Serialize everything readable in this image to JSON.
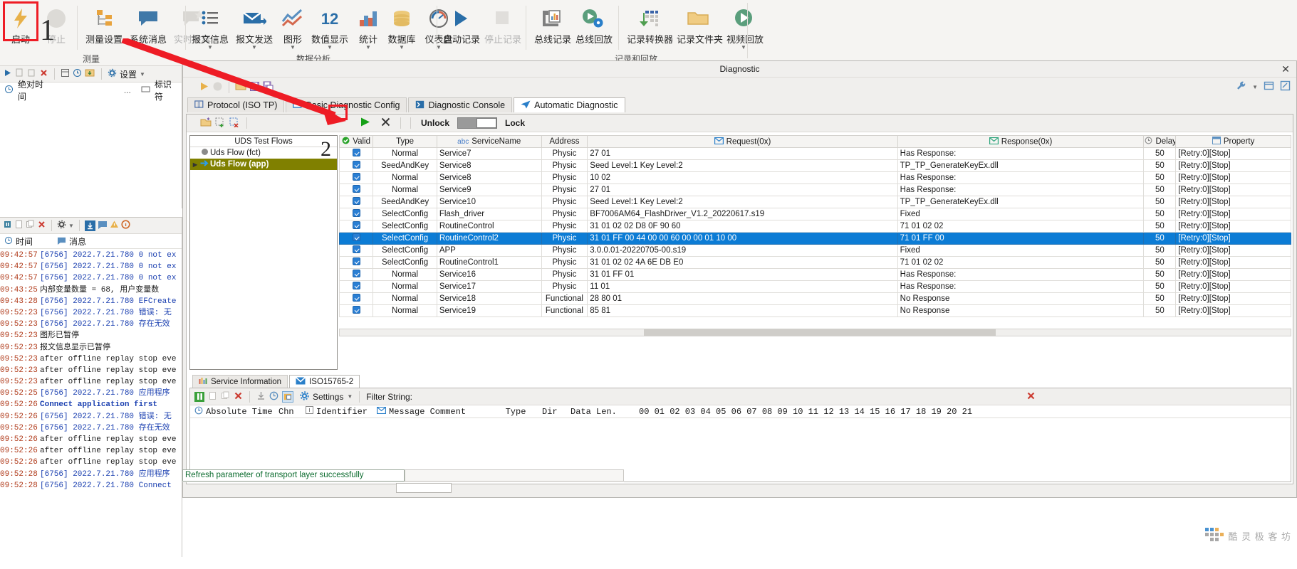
{
  "ribbon": {
    "groups": [
      {
        "name": "测量",
        "items": [
          {
            "label": "启动",
            "icon": "lightning-icon",
            "disabled": false
          },
          {
            "label": "停止",
            "icon": "stop-circle-icon",
            "disabled": true
          },
          {
            "label": "测量设置",
            "icon": "measurement-setup-icon",
            "disabled": false
          },
          {
            "label": "系统消息",
            "icon": "system-message-icon",
            "disabled": false
          },
          {
            "label": "实时注释",
            "icon": "realtime-comment-icon",
            "disabled": true
          }
        ]
      },
      {
        "name": "数据分析",
        "items": [
          {
            "label": "报文信息",
            "icon": "message-info-icon",
            "dropdown": true
          },
          {
            "label": "报文发送",
            "icon": "message-send-icon",
            "dropdown": true
          },
          {
            "label": "图形",
            "icon": "graph-icon",
            "dropdown": true
          },
          {
            "label": "数值显示",
            "icon": "numeric-display-icon",
            "dropdown": true
          },
          {
            "label": "统计",
            "icon": "statistics-icon",
            "dropdown": true
          },
          {
            "label": "数据库",
            "icon": "database-icon",
            "dropdown": true
          },
          {
            "label": "仪表盘",
            "icon": "dashboard-icon",
            "dropdown": true
          }
        ]
      },
      {
        "name": "记录和回放",
        "items": [
          {
            "label": "启动记录",
            "icon": "play-icon",
            "disabled": false
          },
          {
            "label": "停止记录",
            "icon": "stop-square-icon",
            "disabled": true
          },
          {
            "label": "总线记录",
            "icon": "bus-logging-icon",
            "disabled": false
          },
          {
            "label": "总线回放",
            "icon": "bus-replay-icon",
            "disabled": false
          },
          {
            "label": "记录转换器",
            "icon": "log-converter-icon",
            "disabled": false
          },
          {
            "label": "记录文件夹",
            "icon": "folder-icon",
            "disabled": false
          },
          {
            "label": "视频回放",
            "icon": "video-replay-icon",
            "dropdown": true
          }
        ]
      }
    ]
  },
  "left_top": {
    "toolbar_icons": [
      "play-icon",
      "copy-icon",
      "paste-icon",
      "delete-icon",
      "grid-icon",
      "clock-icon",
      "export-icon",
      "settings-icon"
    ],
    "settings_label": "设置",
    "time_mode_label": "绝对时间",
    "ellipsis": "...",
    "identifier_label": "标识符"
  },
  "left_bottom": {
    "toolbar_icons": [
      "pause-icon",
      "new-icon",
      "copy-icon",
      "delete-icon",
      "settings-icon",
      "download-icon",
      "message-icon",
      "warning-icon",
      "info-icon"
    ],
    "col_time": "时间",
    "col_message": "消息",
    "rows": [
      {
        "time": "09:42:57",
        "text": "[6756]  2022.7.21.780  0 not ex",
        "style": "blue"
      },
      {
        "time": "09:42:57",
        "text": "[6756]  2022.7.21.780  0 not ex",
        "style": "blue"
      },
      {
        "time": "09:42:57",
        "text": "[6756]  2022.7.21.780  0 not ex",
        "style": "blue"
      },
      {
        "time": "09:43:25",
        "text": "内部变量数量 = 68, 用户变量数",
        "style": "plain"
      },
      {
        "time": "09:43:28",
        "text": "[6756]  2022.7.21.780  EFCreate",
        "style": "blue"
      },
      {
        "time": "09:52:23",
        "text": "[6756]  2022.7.21.780  错误: 无",
        "style": "blue"
      },
      {
        "time": "09:52:23",
        "text": "[6756]  2022.7.21.780  存在无效",
        "style": "blue"
      },
      {
        "time": "09:52:23",
        "text": "图形已暂停",
        "style": "plain"
      },
      {
        "time": "09:52:23",
        "text": "报文信息显示已暂停",
        "style": "plain"
      },
      {
        "time": "09:52:23",
        "text": "after offline replay stop eve",
        "style": "plain"
      },
      {
        "time": "09:52:23",
        "text": "after offline replay stop eve",
        "style": "plain"
      },
      {
        "time": "09:52:23",
        "text": "after offline replay stop eve",
        "style": "plain"
      },
      {
        "time": "09:52:25",
        "text": "[6756]  2022.7.21.780  应用程序",
        "style": "blue"
      },
      {
        "time": "09:52:26",
        "text": "Connect application first",
        "style": "bold"
      },
      {
        "time": "09:52:26",
        "text": "[6756]  2022.7.21.780  错误: 无",
        "style": "blue"
      },
      {
        "time": "09:52:26",
        "text": "[6756]  2022.7.21.780  存在无效",
        "style": "blue"
      },
      {
        "time": "09:52:26",
        "text": "after offline replay stop eve",
        "style": "plain"
      },
      {
        "time": "09:52:26",
        "text": "after offline replay stop eve",
        "style": "plain"
      },
      {
        "time": "09:52:26",
        "text": "after offline replay stop eve",
        "style": "plain"
      },
      {
        "time": "09:52:28",
        "text": "[6756]  2022.7.21.780  应用程序",
        "style": "blue"
      },
      {
        "time": "09:52:28",
        "text": "[6756]  2022.7.21.780  Connect",
        "style": "blue"
      }
    ]
  },
  "diagnostic": {
    "title": "Diagnostic",
    "close_label": "✕",
    "top_icons": [
      "run-icon",
      "stop-circle-icon",
      "open-folder-icon",
      "save-icon",
      "save-as-icon"
    ],
    "top_right_icons": [
      "wrench-icon",
      "chevron-down-icon",
      "window-icon",
      "edit-icon"
    ],
    "tabs": [
      {
        "label": "Protocol (ISO TP)",
        "icon": "protocol-icon",
        "active": false
      },
      {
        "label": "Basic Diagnostic Config",
        "icon": "config-icon",
        "active": false
      },
      {
        "label": "Diagnostic Console",
        "icon": "console-icon",
        "active": false
      },
      {
        "label": "Automatic Diagnostic",
        "icon": "send-plane-icon",
        "active": true
      }
    ],
    "toolbar2": {
      "icons": [
        "open-folder-icon",
        "add-row-icon",
        "remove-row-icon"
      ],
      "run_icon": "run-green-icon",
      "cancel_icon": "cancel-x-icon",
      "unlock_label": "Unlock",
      "lock_label": "Lock",
      "toggle_state": "Lock"
    },
    "tree": {
      "header": "UDS Test Flows",
      "big_number": "2",
      "nodes": [
        {
          "label": "Uds Flow (fct)",
          "glyph": "gray-circle-icon",
          "selected": false
        },
        {
          "label": "Uds Flow (app)",
          "glyph": "blue-arrow-icon",
          "selected": true
        }
      ]
    },
    "grid": {
      "columns": [
        {
          "label": "Valid",
          "icon": "check-circle-icon"
        },
        {
          "label": "Type",
          "icon": ""
        },
        {
          "label": "ServiceName",
          "icon": "abc-icon"
        },
        {
          "label": "Address",
          "icon": ""
        },
        {
          "label": "Request(0x)",
          "icon": "envelope-blue-icon"
        },
        {
          "label": "Response(0x)",
          "icon": "envelope-green-icon"
        },
        {
          "label": "Delay",
          "icon": "clock-icon"
        },
        {
          "label": "Property",
          "icon": "property-icon"
        }
      ],
      "rows": [
        {
          "valid": true,
          "type": "Normal",
          "service": "Service7",
          "address": "Physic",
          "request": "27 01",
          "response": "Has Response:",
          "delay": "50",
          "property": "[Retry:0][Stop]",
          "selected": false
        },
        {
          "valid": true,
          "type": "SeedAndKey",
          "service": "Service8",
          "address": "Physic",
          "request": "Seed Level:1 Key Level:2",
          "response": "TP_TP_GenerateKeyEx.dll",
          "delay": "50",
          "property": "[Retry:0][Stop]",
          "selected": false
        },
        {
          "valid": true,
          "type": "Normal",
          "service": "Service8",
          "address": "Physic",
          "request": "10 02",
          "response": "Has Response:",
          "delay": "50",
          "property": "[Retry:0][Stop]",
          "selected": false
        },
        {
          "valid": true,
          "type": "Normal",
          "service": "Service9",
          "address": "Physic",
          "request": "27 01",
          "response": "Has Response:",
          "delay": "50",
          "property": "[Retry:0][Stop]",
          "selected": false
        },
        {
          "valid": true,
          "type": "SeedAndKey",
          "service": "Service10",
          "address": "Physic",
          "request": "Seed Level:1 Key Level:2",
          "response": "TP_TP_GenerateKeyEx.dll",
          "delay": "50",
          "property": "[Retry:0][Stop]",
          "selected": false
        },
        {
          "valid": true,
          "type": "SelectConfig",
          "service": "Flash_driver",
          "address": "Physic",
          "request": "BF7006AM64_FlashDriver_V1.2_20220617.s19",
          "response": "Fixed",
          "delay": "50",
          "property": "[Retry:0][Stop]",
          "selected": false
        },
        {
          "valid": true,
          "type": "SelectConfig",
          "service": "RoutineControl",
          "address": "Physic",
          "request": "31 01 02 02 D8 0F 90 60",
          "response": "71 01 02 02",
          "delay": "50",
          "property": "[Retry:0][Stop]",
          "selected": false
        },
        {
          "valid": true,
          "type": "SelectConfig",
          "service": "RoutineControl2",
          "address": "Physic",
          "request": "31 01 FF 00 44 00 00 60 00 00 01 10 00",
          "response": "71 01 FF 00",
          "delay": "50",
          "property": "[Retry:0][Stop]",
          "selected": true
        },
        {
          "valid": true,
          "type": "SelectConfig",
          "service": "APP",
          "address": "Physic",
          "request": "3.0.0.01-20220705-00.s19",
          "response": "Fixed",
          "delay": "50",
          "property": "[Retry:0][Stop]",
          "selected": false
        },
        {
          "valid": true,
          "type": "SelectConfig",
          "service": "RoutineControl1",
          "address": "Physic",
          "request": "31 01 02 02 4A 6E DB E0",
          "response": "71 01 02 02",
          "delay": "50",
          "property": "[Retry:0][Stop]",
          "selected": false
        },
        {
          "valid": true,
          "type": "Normal",
          "service": "Service16",
          "address": "Physic",
          "request": "31 01 FF 01",
          "response": "Has Response:",
          "delay": "50",
          "property": "[Retry:0][Stop]",
          "selected": false
        },
        {
          "valid": true,
          "type": "Normal",
          "service": "Service17",
          "address": "Physic",
          "request": "11 01",
          "response": "Has Response:",
          "delay": "50",
          "property": "[Retry:0][Stop]",
          "selected": false
        },
        {
          "valid": true,
          "type": "Normal",
          "service": "Service18",
          "address": "Functional",
          "request": "28 80 01",
          "response": "No Response",
          "delay": "50",
          "property": "[Retry:0][Stop]",
          "selected": false
        },
        {
          "valid": true,
          "type": "Normal",
          "service": "Service19",
          "address": "Functional",
          "request": "85 81",
          "response": "No Response",
          "delay": "50",
          "property": "[Retry:0][Stop]",
          "selected": false
        }
      ]
    },
    "bottom": {
      "tabs": [
        {
          "label": "Service Information",
          "icon": "bars-icon",
          "active": false
        },
        {
          "label": "ISO15765-2",
          "icon": "envelope-blue-icon",
          "active": true
        }
      ],
      "toolbar": {
        "icons": [
          "pause-green-icon",
          "copy-icon",
          "paste-icon",
          "delete-red-icon",
          "scroll-bottom-icon",
          "clock-icon",
          "export-icon",
          "gear-icon"
        ],
        "settings_label": "Settings",
        "filter_label": "Filter String:",
        "filter_value": "",
        "clear_icon": "clear-red-x-icon"
      },
      "columns": [
        {
          "label": "Absolute  Time",
          "icon": "clock-icon"
        },
        {
          "label": "Chn",
          "icon": ""
        },
        {
          "label": "Identifier",
          "icon": "id-icon"
        },
        {
          "label": "Message Comment",
          "icon": "envelope-blue-icon"
        },
        {
          "label": "Type",
          "icon": ""
        },
        {
          "label": "Dir",
          "icon": ""
        },
        {
          "label": "Data Len.",
          "icon": ""
        },
        {
          "label": "00 01 02 03 04 05 06 07 08 09 10 11 12 13 14 15 16 17 18 19 20 21",
          "icon": ""
        }
      ]
    }
  },
  "statusbar": {
    "message": "Refresh parameter of transport layer successfully"
  },
  "watermark": {
    "text": "酷 灵 极 客 坊"
  },
  "annotations": {
    "num1": "1",
    "num2": "2"
  },
  "colors": {
    "accent_blue": "#0c7cd5",
    "selection_olive": "#808000",
    "annotation_red": "#ee1c25",
    "status_green": "#0b6b2e"
  }
}
